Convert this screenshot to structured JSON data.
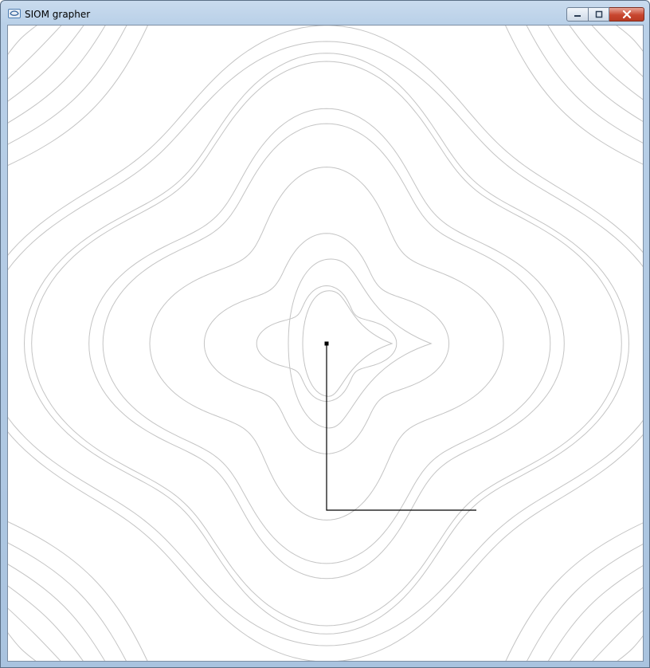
{
  "window": {
    "title": "SIOM grapher",
    "icon": "app-icon",
    "controls": [
      "minimize-icon",
      "maximize-icon",
      "close-icon"
    ]
  },
  "plot": {
    "background": "#ffffff",
    "contour_color": "#c4c4c4",
    "path_color": "#000000",
    "frame_color": "#4f7fb3"
  }
}
